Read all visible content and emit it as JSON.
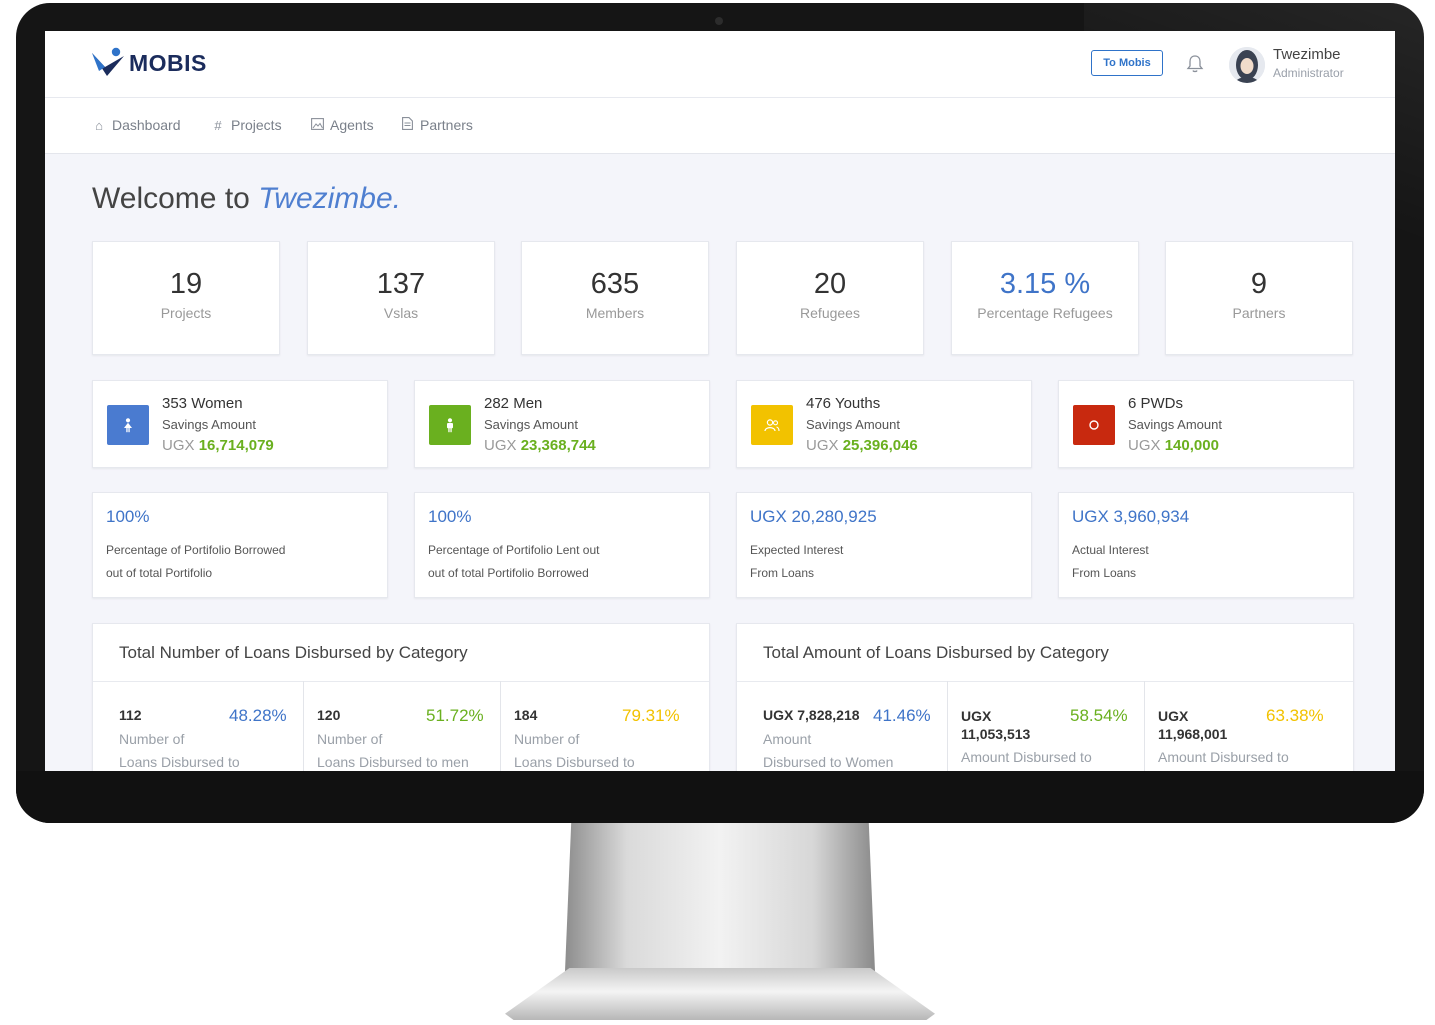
{
  "app": {
    "brand": "MOBIS"
  },
  "header": {
    "to_mobis": "To Mobis",
    "user_name": "Twezimbe",
    "user_role": "Administrator"
  },
  "nav": [
    {
      "label": "Dashboard",
      "icon": "home-icon"
    },
    {
      "label": "Projects",
      "icon": "hash-icon"
    },
    {
      "label": "Agents",
      "icon": "image-icon"
    },
    {
      "label": "Partners",
      "icon": "document-icon"
    }
  ],
  "welcome": {
    "prefix": "Welcome to",
    "name": "Twezimbe."
  },
  "stats": [
    {
      "value": "19",
      "label": "Projects"
    },
    {
      "value": "137",
      "label": "Vslas"
    },
    {
      "value": "635",
      "label": "Members"
    },
    {
      "value": "20",
      "label": "Refugees"
    },
    {
      "value": "3.15 %",
      "label": "Percentage Refugees"
    },
    {
      "value": "9",
      "label": "Partners"
    }
  ],
  "demographics": [
    {
      "count": "353",
      "group": "Women",
      "sub": "Savings Amount",
      "currency": "UGX",
      "amount": "16,714,079",
      "color": "#4a7bd0",
      "icon": "female-icon"
    },
    {
      "count": "282",
      "group": "Men",
      "sub": "Savings Amount",
      "currency": "UGX",
      "amount": "23,368,744",
      "color": "#6ab01f",
      "icon": "male-icon"
    },
    {
      "count": "476",
      "group": "Youths",
      "sub": "Savings Amount",
      "currency": "UGX",
      "amount": "25,396,046",
      "color": "#f2c200",
      "icon": "users-icon"
    },
    {
      "count": "6",
      "group": "PWDs",
      "sub": "Savings Amount",
      "currency": "UGX",
      "amount": "140,000",
      "color": "#c8290f",
      "icon": "circle-icon"
    }
  ],
  "portfolio": [
    {
      "value": "100%",
      "line1": "Percentage of Portifolio Borrowed",
      "line2": "out of total Portifolio"
    },
    {
      "value": "100%",
      "line1": "Percentage of Portifolio Lent out",
      "line2": "out of total Portifolio Borrowed"
    },
    {
      "value": "UGX 20,280,925",
      "line1": "Expected Interest",
      "line2": "From Loans"
    },
    {
      "value": "UGX 3,960,934",
      "line1": "Actual Interest",
      "line2": "From Loans"
    }
  ],
  "loans_number": {
    "title": "Total Number of Loans Disbursed by Category",
    "cells": [
      {
        "number": "112",
        "pct": "48.28%",
        "line1": "Number of",
        "line2": "Loans Disbursed to",
        "color": "#3f74c8"
      },
      {
        "number": "120",
        "pct": "51.72%",
        "line1": "Number of",
        "line2": "Loans Disbursed to men",
        "color": "#6ab01f"
      },
      {
        "number": "184",
        "pct": "79.31%",
        "line1": "Number of",
        "line2": "Loans Disbursed to",
        "color": "#f2c200"
      }
    ]
  },
  "loans_amount": {
    "title": "Total Amount of Loans Disbursed by Category",
    "cells": [
      {
        "number": "UGX 7,828,218",
        "pct": "41.46%",
        "line1": "Amount",
        "line2": "Disbursed to Women",
        "color": "#3f74c8"
      },
      {
        "number": "UGX 11,053,513",
        "pct": "58.54%",
        "line1": "Amount Disbursed to",
        "line2": "",
        "color": "#6ab01f"
      },
      {
        "number": "UGX 11,968,001",
        "pct": "63.38%",
        "line1": "Amount Disbursed to",
        "line2": "",
        "color": "#f2c200"
      }
    ]
  }
}
